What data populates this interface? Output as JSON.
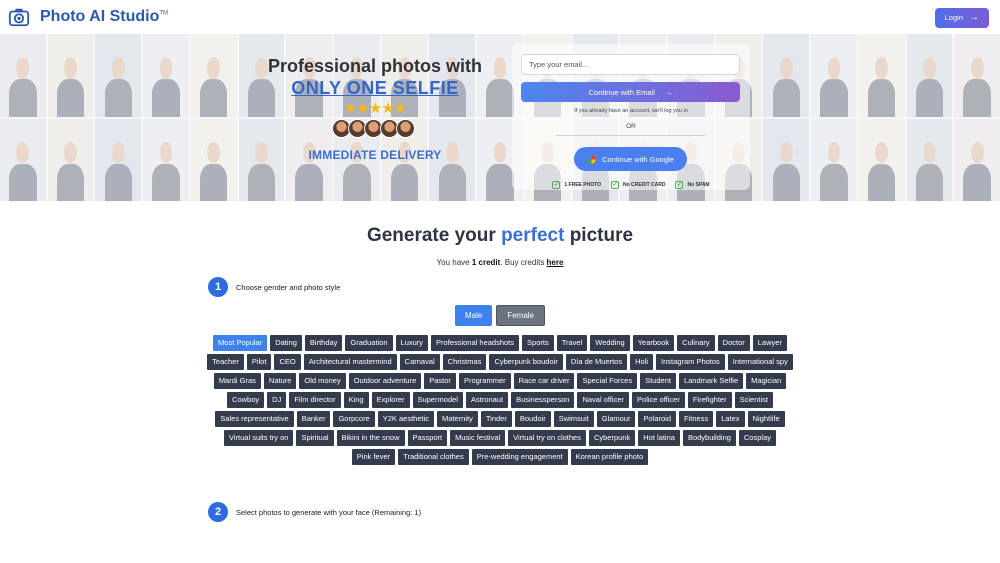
{
  "header": {
    "brand": "Photo AI Studio",
    "trademark": "TM",
    "login_label": "Login",
    "login_icon": "arrow-right-icon"
  },
  "hero": {
    "title": "Professional photos with",
    "subtitle": "ONLY ONE SELFIE",
    "rating_stars": 5,
    "stars_text": "★★★★★",
    "avatar_count": 5,
    "delivery": "IMMEDIATE DELIVERY",
    "signup": {
      "email_placeholder": "Type your email...",
      "email_value": "",
      "continue_email_label": "Continue with Email",
      "hint": "If you already have an account, we'll log you in",
      "or_label": "OR",
      "continue_google_label": "Continue with Google",
      "badges": [
        "1 FREE PHOTO",
        "No CREDIT CARD",
        "No SPAM"
      ]
    }
  },
  "main": {
    "title_prefix": "Generate your ",
    "title_highlight": "perfect",
    "title_suffix": " picture",
    "credits_prefix": "You have ",
    "credits_value": "1 credit",
    "credits_middle": ". Buy credits ",
    "credits_link": "here",
    "step1": {
      "number": "1",
      "label": "Choose gender and photo style"
    },
    "step2": {
      "number": "2",
      "label": "Select photos to generate with your face (Remaining: 1)"
    },
    "gender": {
      "options": [
        "Male",
        "Female"
      ],
      "selected": "Male"
    },
    "styles": {
      "selected": "Most Popular",
      "items": [
        "Most Popular",
        "Dating",
        "Birthday",
        "Graduation",
        "Luxury",
        "Professional headshots",
        "Sports",
        "Travel",
        "Wedding",
        "Yearbook",
        "Culinary",
        "Doctor",
        "Lawyer",
        "Teacher",
        "Pilot",
        "CEO",
        "Architectural mastermind",
        "Carnaval",
        "Christmas",
        "Cyberpunk boudoir",
        "Día de Muertos",
        "Holi",
        "Instagram Photos",
        "International spy",
        "Mardi Gras",
        "Nature",
        "Old money",
        "Outdoor adventure",
        "Pastor",
        "Programmer",
        "Race car driver",
        "Special Forces",
        "Student",
        "Landmark Selfie",
        "Magician",
        "Cowboy",
        "DJ",
        "Film director",
        "King",
        "Explorer",
        "Supermodel",
        "Astronaut",
        "Businessperson",
        "Naval officer",
        "Police officer",
        "Firefighter",
        "Scientist",
        "Sales representative",
        "Banker",
        "Gorpcore",
        "Y2K aesthetic",
        "Maternity",
        "Tinder",
        "Boudoir",
        "Swimsuit",
        "Glamour",
        "Polaroid",
        "Fitness",
        "Latex",
        "Nightlife",
        "Virtual suits try on",
        "Spiritual",
        "Bikini in the snow",
        "Passport",
        "Music festival",
        "Virtual try on clothes",
        "Cyberpunk",
        "Hot latina",
        "Bodybuilding",
        "Cosplay",
        "Pink fever",
        "Traditional clothes",
        "Pre-wedding engagement",
        "Korean profile photo"
      ]
    }
  },
  "colors": {
    "brand": "#2d5ba8",
    "accent": "#3e82ee",
    "tag_bg": "#333b4d",
    "star": "#f5b914"
  }
}
